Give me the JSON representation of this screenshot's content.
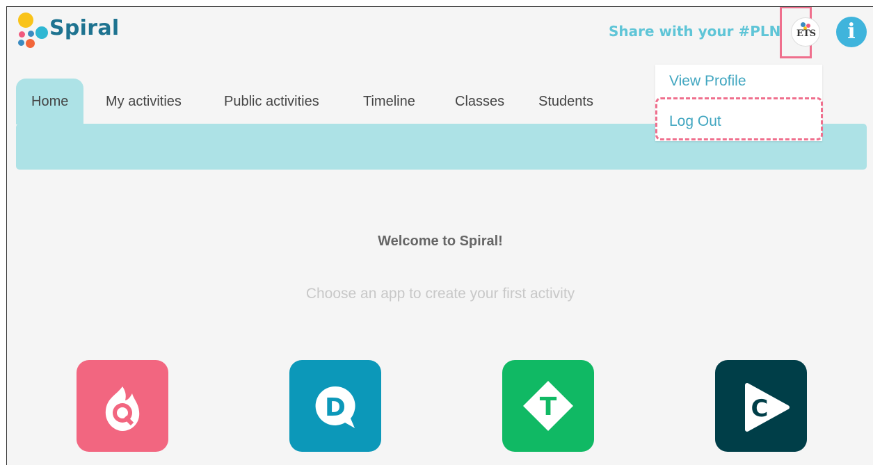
{
  "header": {
    "logo_text": "Spiral",
    "share_link": "Share with your #PLN",
    "avatar_text": "ETS",
    "info_icon": "i"
  },
  "tabs": [
    {
      "label": "Home",
      "active": true
    },
    {
      "label": "My activities"
    },
    {
      "label": "Public activities"
    },
    {
      "label": "Timeline"
    },
    {
      "label": "Classes"
    },
    {
      "label": "Students"
    }
  ],
  "profile_menu": {
    "items": [
      {
        "label": "View Profile"
      },
      {
        "label": "Log Out"
      }
    ]
  },
  "main": {
    "welcome": "Welcome to Spiral!",
    "subtitle": "Choose an app to create your first activity",
    "apps": [
      {
        "icon": "quickfire-icon",
        "letter": "Q",
        "color": "#f26680"
      },
      {
        "icon": "discuss-icon",
        "letter": "D",
        "color": "#0c98b9"
      },
      {
        "icon": "team-up-icon",
        "letter": "T",
        "color": "#10b964"
      },
      {
        "icon": "clip-icon",
        "letter": "C",
        "color": "#003e48"
      }
    ]
  },
  "colors": {
    "brand_teal": "#1e7390",
    "accent_pink": "#ef6f8d",
    "tab_bar": "#ade2e6"
  }
}
